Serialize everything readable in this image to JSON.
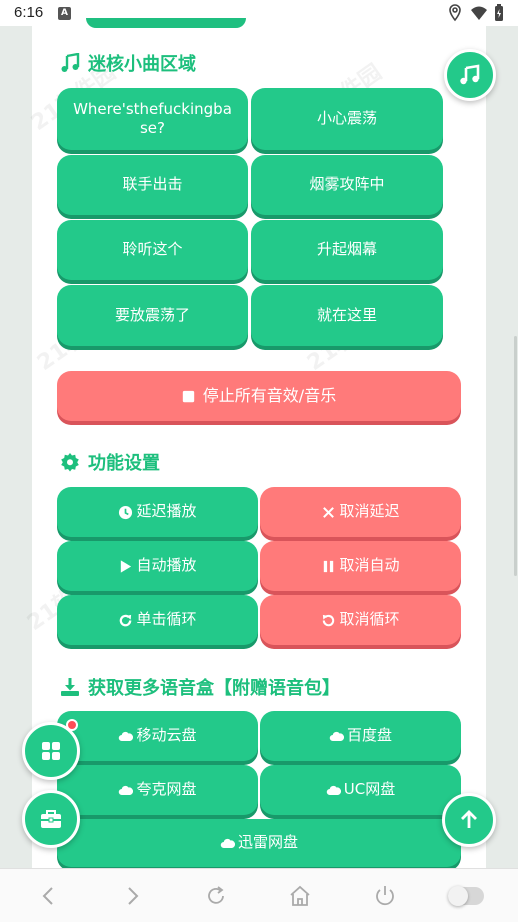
{
  "status_bar": {
    "time": "6:16"
  },
  "sections": {
    "music": {
      "title": "迷核小曲区域",
      "buttons": [
        "Where'sthefuckingbase?",
        "小心震荡",
        "联手出击",
        "烟雾攻阵中",
        "聆听这个",
        "升起烟幕",
        "要放震荡了",
        "就在这里"
      ]
    },
    "stop_all": "停止所有音效/音乐",
    "settings": {
      "title": "功能设置",
      "buttons": [
        "延迟播放",
        "取消延迟",
        "自动播放",
        "取消自动",
        "单击循环",
        "取消循环"
      ]
    },
    "download": {
      "title": "获取更多语音盒【附赠语音包】",
      "buttons": [
        "移动云盘",
        "百度盘",
        "夸克网盘",
        "UC网盘",
        "迅雷网盘"
      ]
    }
  },
  "watermark": "21软件园",
  "colors": {
    "accent": "#23c98a",
    "danger": "#ff7a7a",
    "title": "#1dbf7d"
  }
}
